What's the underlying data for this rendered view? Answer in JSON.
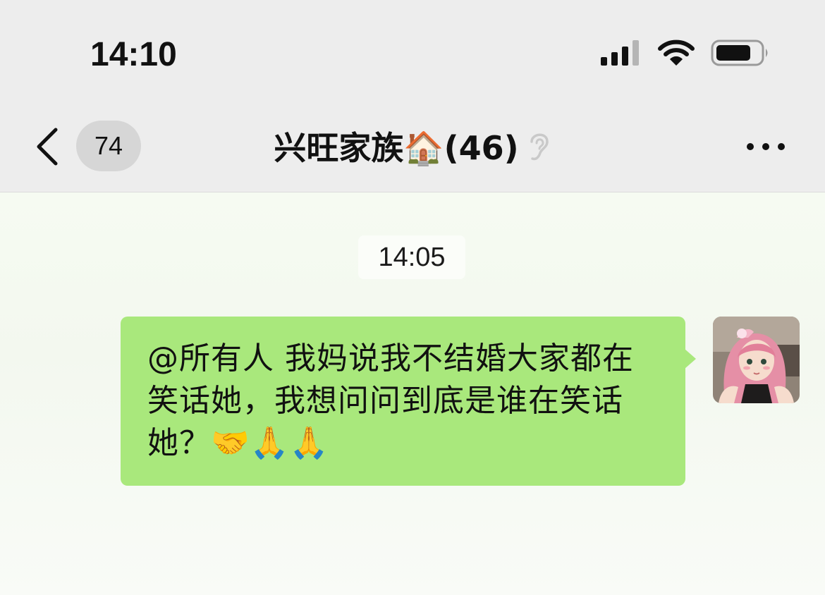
{
  "status_bar": {
    "time": "14:10",
    "icons": [
      "cellular-signal-icon",
      "wifi-icon",
      "battery-icon"
    ]
  },
  "nav": {
    "unread_count": "74",
    "title": "兴旺家族🏠(46)",
    "icons": [
      "back-chevron-icon",
      "ear-icon",
      "more-dots-icon"
    ]
  },
  "chat": {
    "timestamp": "14:05",
    "messages": [
      {
        "sender": "self",
        "text": "@所有人 我妈说我不结婚大家都在笑话她，我想问问到底是谁在笑话她？🤝🙏🙏",
        "bubble_color": "#a9e87c"
      }
    ]
  },
  "colors": {
    "header_bg": "#ededed",
    "chat_bg": "#f6fbf2",
    "bubble_bg": "#a9e87c",
    "badge_bg": "#d6d6d6"
  }
}
